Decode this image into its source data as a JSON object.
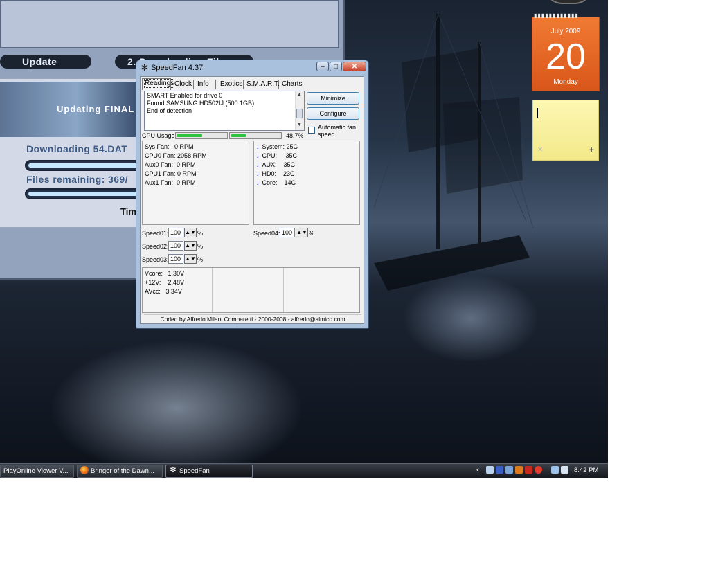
{
  "updater": {
    "step1_label": "Update",
    "step2_label": "2. Downloading Files",
    "banner_text": "Updating FINAL",
    "downloading_label": "Downloading 54.DAT",
    "files_remaining_label": "Files remaining: 369/",
    "time_label": "Tim"
  },
  "speedfan": {
    "title": "SpeedFan 4.37",
    "tabs": [
      "Readings",
      "Clock",
      "Info",
      "Exotics",
      "S.M.A.R.T.",
      "Charts"
    ],
    "log_lines": [
      "SMART Enabled for drive 0",
      "Found SAMSUNG HD502IJ (500.1GB)",
      "End of detection"
    ],
    "minimize_label": "Minimize",
    "configure_label": "Configure",
    "auto_fan_label_1": "Automatic fan",
    "auto_fan_label_2": "speed",
    "cpu_usage_label": "CPU Usage",
    "cpu_usage_value": "48.7%",
    "cpu_core_fractions": [
      0.52,
      0.3
    ],
    "fans": [
      {
        "name": "Sys Fan:",
        "value": "0 RPM"
      },
      {
        "name": "CPU0 Fan:",
        "value": "2058 RPM"
      },
      {
        "name": "Aux0 Fan:",
        "value": "0 RPM"
      },
      {
        "name": "CPU1 Fan:",
        "value": "0 RPM"
      },
      {
        "name": "Aux1 Fan:",
        "value": "0 RPM"
      }
    ],
    "temps": [
      {
        "name": "System:",
        "value": "25C"
      },
      {
        "name": "CPU:",
        "value": "35C"
      },
      {
        "name": "AUX:",
        "value": "35C"
      },
      {
        "name": "HD0:",
        "value": "23C"
      },
      {
        "name": "Core:",
        "value": "14C"
      }
    ],
    "speeds": [
      {
        "name": "Speed01:",
        "value": "100"
      },
      {
        "name": "Speed02:",
        "value": "100"
      },
      {
        "name": "Speed03:",
        "value": "100"
      },
      {
        "name": "Speed04:",
        "value": "100"
      }
    ],
    "percent_sign": "%",
    "voltages": [
      {
        "name": "Vcore:",
        "value": "1.30V"
      },
      {
        "name": "+12V:",
        "value": "2.48V"
      },
      {
        "name": "AVcc:",
        "value": "3.34V"
      }
    ],
    "footer": "Coded by Alfredo Milani Comparetti - 2000-2008 - alfredo@almico.com"
  },
  "calendar": {
    "month_year": "July 2009",
    "day": "20",
    "weekday": "Monday"
  },
  "sticky_note": {
    "text": ""
  },
  "taskbar": {
    "tasks": [
      {
        "label": "PlayOnline Viewer V..."
      },
      {
        "label": "Bringer of the Dawn..."
      },
      {
        "label": "SpeedFan"
      }
    ],
    "clock": "8:42 PM"
  },
  "colors": {
    "cpu_bar": "#2fc23f",
    "calendar": "#e4621f",
    "note": "#fbf3a6",
    "temp_arrow": "#1a2fd1"
  }
}
